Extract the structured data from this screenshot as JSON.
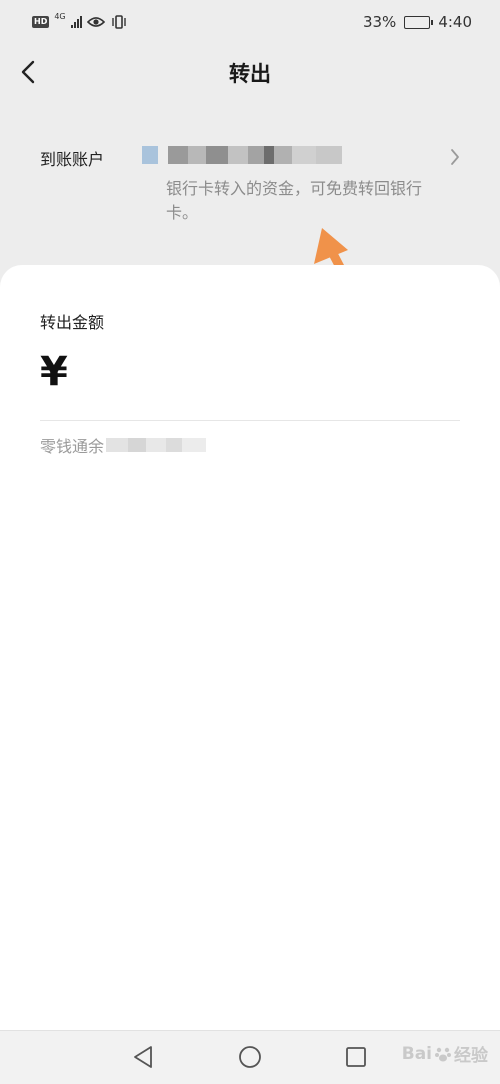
{
  "status_bar": {
    "hd": "HD",
    "network": "4G",
    "battery_text": "33%",
    "time": "4:40",
    "battery_level": 0.33
  },
  "header": {
    "title": "转出"
  },
  "account": {
    "label": "到账账户",
    "hint": "银行卡转入的资金，可免费转回银行卡。"
  },
  "amount": {
    "label": "转出金额",
    "currency": "¥",
    "balance_label": "零钱通余"
  },
  "watermark": {
    "text": "Bai",
    "suffix": "经验"
  },
  "colors": {
    "background": "#ededed",
    "card": "#ffffff",
    "arrow": "#f0924a",
    "hint": "#8c8c8c"
  }
}
